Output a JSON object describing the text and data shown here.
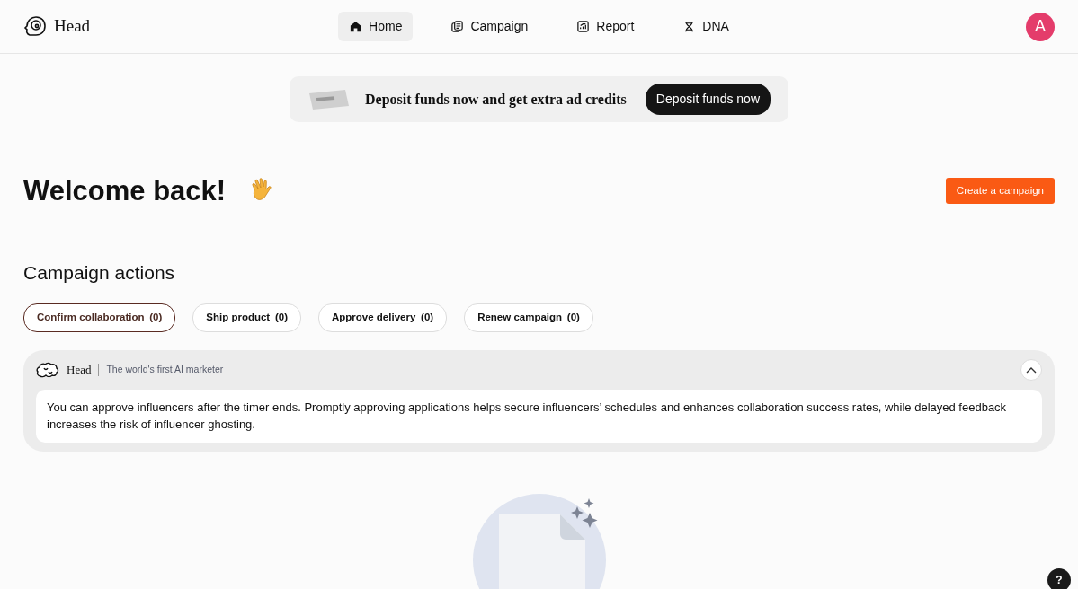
{
  "brand": {
    "name": "Head"
  },
  "nav": [
    {
      "label": "Home",
      "kind": "home",
      "selected": true
    },
    {
      "label": "Campaign",
      "kind": "campaign",
      "selected": false
    },
    {
      "label": "Report",
      "kind": "report",
      "selected": false
    },
    {
      "label": "DNA",
      "kind": "dna",
      "selected": false
    }
  ],
  "avatar": {
    "initial": "A"
  },
  "banner": {
    "text": "Deposit funds now and get extra ad credits",
    "button": "Deposit funds now"
  },
  "welcome": {
    "title": "Welcome back!",
    "button": "Create a campaign"
  },
  "actions": {
    "title": "Campaign actions",
    "filters": [
      {
        "label": "Confirm collaboration",
        "count": "(0)",
        "selected": true
      },
      {
        "label": "Ship product",
        "count": "(0)",
        "selected": false
      },
      {
        "label": "Approve delivery",
        "count": "(0)",
        "selected": false
      },
      {
        "label": "Renew campaign",
        "count": "(0)",
        "selected": false
      }
    ]
  },
  "assistant": {
    "name": "Head",
    "tagline": "The world's first AI marketer",
    "expanded": true,
    "message": "You can approve influencers after the timer ends. Promptly approving applications helps secure influencers’ schedules and enhances collaboration success rates, while delayed feedback increases the risk of influencer ghosting."
  },
  "help": {
    "label": "?"
  }
}
